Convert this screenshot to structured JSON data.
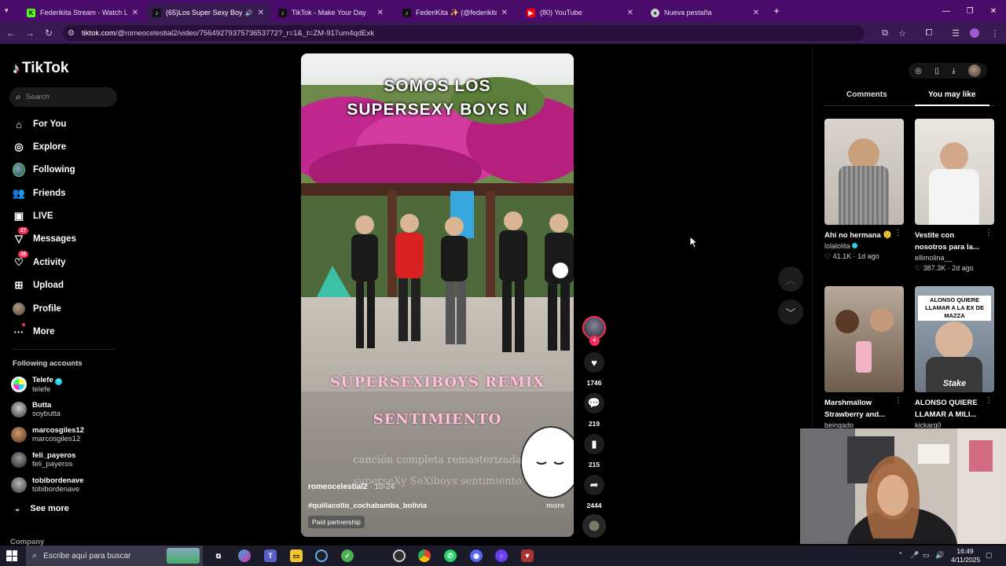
{
  "browser": {
    "tabs": [
      {
        "label": "Federikita Stream - Watch Live",
        "icon": "kick-icon",
        "color": "#53fc18"
      },
      {
        "label": "(65)Los Super Sexy Boys: Re",
        "icon": "tiktok-icon",
        "color": "#111111"
      },
      {
        "label": "TikTok - Make Your Day",
        "icon": "tiktok-icon",
        "color": "#111111"
      },
      {
        "label": "FederiKita ✨ (@federikita)",
        "icon": "tiktok-icon",
        "color": "#111111"
      },
      {
        "label": "(80) YouTube",
        "icon": "youtube-icon",
        "color": "#ff0000"
      },
      {
        "label": "Nueva pestaña",
        "icon": "chrome-icon",
        "color": "#cccccc"
      }
    ],
    "url_host": "tiktok.com",
    "url_path": "/@romeocelestial2/video/7564927937573653772?_r=1&_t=ZM-917um4qdExk"
  },
  "sidebar": {
    "logo": "TikTok",
    "search_placeholder": "Search",
    "nav": [
      {
        "label": "For You",
        "icon": "home-icon"
      },
      {
        "label": "Explore",
        "icon": "compass-icon"
      },
      {
        "label": "Following",
        "icon": "following-avatar-icon"
      },
      {
        "label": "Friends",
        "icon": "friends-icon"
      },
      {
        "label": "LIVE",
        "icon": "live-icon"
      },
      {
        "label": "Messages",
        "icon": "messages-icon",
        "badge": "27"
      },
      {
        "label": "Activity",
        "icon": "activity-icon",
        "badge": "38"
      },
      {
        "label": "Upload",
        "icon": "upload-icon"
      },
      {
        "label": "Profile",
        "icon": "profile-avatar-icon"
      },
      {
        "label": "More",
        "icon": "more-dots-icon"
      }
    ],
    "following_title": "Following accounts",
    "accounts": [
      {
        "name": "Telefe",
        "handle": "telefe",
        "verified": true
      },
      {
        "name": "Butta",
        "handle": "soybutta"
      },
      {
        "name": "marcosgiles12",
        "handle": "marcosgiles12"
      },
      {
        "name": "feli_payeros",
        "handle": "feli_payeros"
      },
      {
        "name": "tobibordenave",
        "handle": "tobibordenave"
      }
    ],
    "see_more": "See more",
    "company": "Company"
  },
  "video": {
    "title_line1": "SOMOS LOS",
    "title_line2": "SUPERSEXY BOYS N",
    "overlay1": "SÚPERSEXIBOYS REMIX",
    "overlay2": "SENTIMIENTO",
    "overlay3": "canción completa remasterizada",
    "overlay4": "superseXy SeXiboys sentimiento",
    "author": "romeocelestial2",
    "date": "10-24",
    "hashtag": "#quillacollo_cochabamba_bolivia",
    "more": "more",
    "paid": "Paid partnership"
  },
  "actions": {
    "likes": "1746",
    "comments": "219",
    "saves": "215",
    "shares": "2444"
  },
  "right_panel": {
    "tab_comments": "Comments",
    "tab_you_may_like": "You may like",
    "cards": [
      {
        "title": "Ahí no hermana 🫠",
        "author": "lolalolita",
        "meta": "♡ 41.1K · 1d ago",
        "verified": true
      },
      {
        "title": "Vestite con nosotros para la...",
        "author": "ellimolina__",
        "meta": "♡ 387.3K · 2d ago"
      },
      {
        "title": "Marshmallow Strawberry and...",
        "author": "beingado",
        "meta": ""
      },
      {
        "title": "ALONSO QUIERE LLAMAR A MILI...",
        "author": "kickarg0",
        "meta": "",
        "thumb_text": "ALONSO QUIERE LLAMAR A LA EX DE MAZZA",
        "thumb_brand": "Stake"
      }
    ]
  },
  "taskbar": {
    "search_placeholder": "Escribe aquí para buscar",
    "time": "16:49",
    "date": "4/11/2025"
  }
}
